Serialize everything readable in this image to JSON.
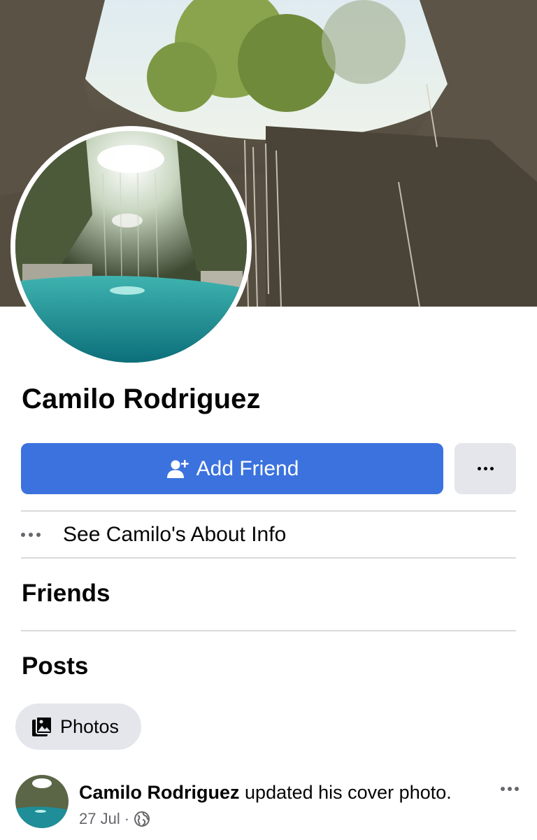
{
  "profile": {
    "name": "Camilo Rodriguez"
  },
  "actions": {
    "add_friend_label": "Add Friend",
    "about_label": "See Camilo's About Info"
  },
  "sections": {
    "friends_title": "Friends",
    "posts_title": "Posts",
    "photos_chip_label": "Photos"
  },
  "post": {
    "author": "Camilo Rodriguez",
    "action_text": "updated his cover photo.",
    "date": "27 Jul",
    "separator": "·",
    "privacy_icon": "globe-icon"
  },
  "colors": {
    "primary_button": "#3b72de",
    "secondary_button": "#e4e6eb",
    "divider": "#d9dadd",
    "meta_text": "#65676b"
  }
}
